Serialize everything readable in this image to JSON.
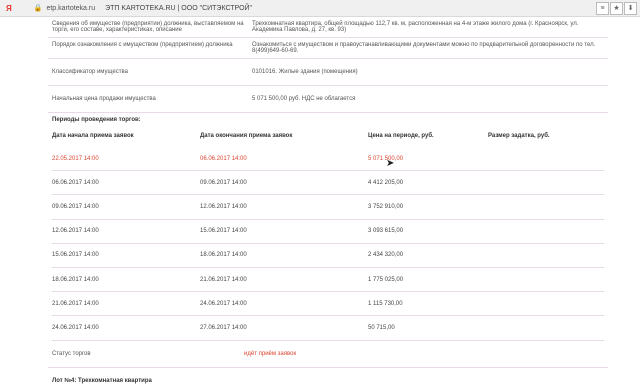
{
  "browser": {
    "logo": "Я",
    "url": "etp.kartoteka.ru",
    "title": "ЭТП KARTOTEKA.RU | ООО \"СИТЭКСТРОЙ\"",
    "buttons": [
      "≡",
      "★",
      "⬇"
    ]
  },
  "info": [
    {
      "label": "Сведения об имуществе (предприятии) должника, выставляемом на торги, его составе, характеристиках, описание",
      "value": "Трехкомнатная квартира, общей площадью 112,7 кв. м, расположенная на 4-м этаже жилого дома (г. Красноярск, ул. Академика Павлова, д. 27, кв. 93)"
    },
    {
      "label": "Порядок ознакомления с имуществом (предприятием) должника",
      "value": "Ознакомиться с имуществом и правоустанавливающими документами можно по предварительной договоренности по тел. 8(499)649-60-69."
    },
    {
      "label": "Классификатор имущества",
      "value": "0101016. Жилые здания (помещения)"
    },
    {
      "label": "Начальная цена продажи имущества",
      "value": "5 071 500,00 руб. НДС не облагается"
    }
  ],
  "periods": {
    "title": "Периоды проведения торгов:",
    "headers": [
      "Дата начала приема заявок",
      "Дата окончания приема заявок",
      "Цена на периоде, руб.",
      "Размер задатка, руб."
    ],
    "rows": [
      {
        "start": "22.05.2017 14:00",
        "end": "06.06.2017 14:00",
        "price": "5 071 500,00",
        "deposit": "",
        "active": true
      },
      {
        "start": "06.06.2017 14:00",
        "end": "09.06.2017 14:00",
        "price": "4 412 205,00",
        "deposit": "",
        "active": false
      },
      {
        "start": "09.06.2017 14:00",
        "end": "12.06.2017 14:00",
        "price": "3 752 910,00",
        "deposit": "",
        "active": false
      },
      {
        "start": "12.06.2017 14:00",
        "end": "15.06.2017 14:00",
        "price": "3 093 615,00",
        "deposit": "",
        "active": false
      },
      {
        "start": "15.06.2017 14:00",
        "end": "18.06.2017 14:00",
        "price": "2 434 320,00",
        "deposit": "",
        "active": false
      },
      {
        "start": "18.06.2017 14:00",
        "end": "21.06.2017 14:00",
        "price": "1 775 025,00",
        "deposit": "",
        "active": false
      },
      {
        "start": "21.06.2017 14:00",
        "end": "24.06.2017 14:00",
        "price": "1 115 730,00",
        "deposit": "",
        "active": false
      },
      {
        "start": "24.06.2017 14:00",
        "end": "27.06.2017 14:00",
        "price": "50 715,00",
        "deposit": "",
        "active": false
      }
    ]
  },
  "status": {
    "label": "Статус торгов",
    "value": "идёт приём заявок"
  },
  "lot": "Лот №4: Трехкомнатная квартира",
  "colors": {
    "accent_red": "#d9442e",
    "divider": "#e6dbe6"
  }
}
